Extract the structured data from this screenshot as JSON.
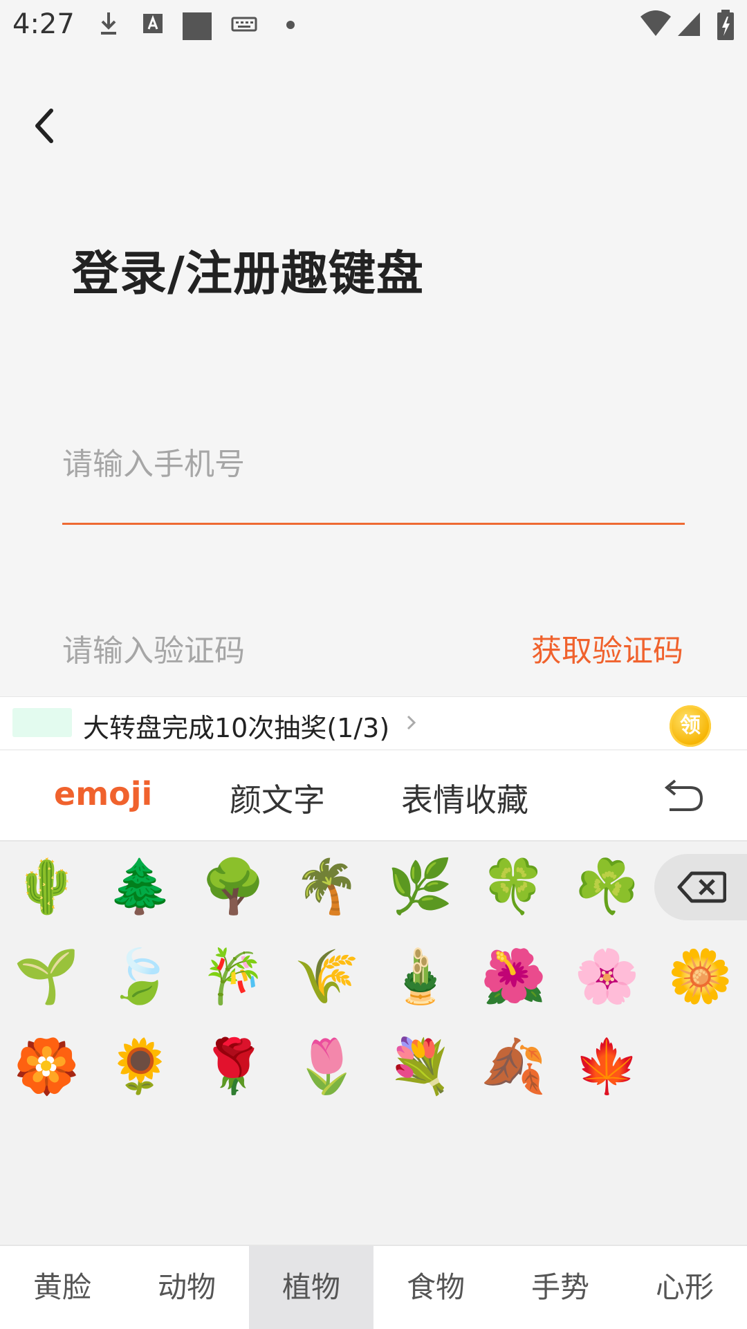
{
  "status_bar": {
    "time": "4:27",
    "left_icons": [
      "download-icon",
      "font-a-icon",
      "square-icon",
      "keyboard-icon",
      "dot-icon"
    ],
    "right_icons": [
      "wifi-icon",
      "signal-icon",
      "battery-charging-icon"
    ]
  },
  "header": {
    "back_icon": "chevron-left-icon",
    "title": "登录/注册趣键盘"
  },
  "form": {
    "phone_placeholder": "请输入手机号",
    "code_placeholder": "请输入验证码",
    "get_code_label": "获取验证码",
    "accent_color": "#f0622d"
  },
  "promo": {
    "text": "大转盘完成10次抽奖(1/3)",
    "coin_label": "领"
  },
  "keyboard": {
    "tabs": [
      "emoji",
      "颜文字",
      "表情收藏"
    ],
    "active_tab": "emoji",
    "undo_icon": "undo-arrow-icon",
    "delete_icon": "backspace-icon",
    "emojis": [
      "🌵",
      "🌲",
      "🌳",
      "🌴",
      "🌿",
      "🍀",
      "☘️",
      "🌱",
      "🍃",
      "🎋",
      "🌾",
      "🎍",
      "🌺",
      "🌸",
      "🌼",
      "🏵️",
      "🌻",
      "🌹",
      "🌷",
      "💐",
      "🍂",
      "🍁"
    ],
    "categories": [
      "黄脸",
      "动物",
      "植物",
      "食物",
      "手势",
      "心形"
    ],
    "active_category": "植物"
  }
}
